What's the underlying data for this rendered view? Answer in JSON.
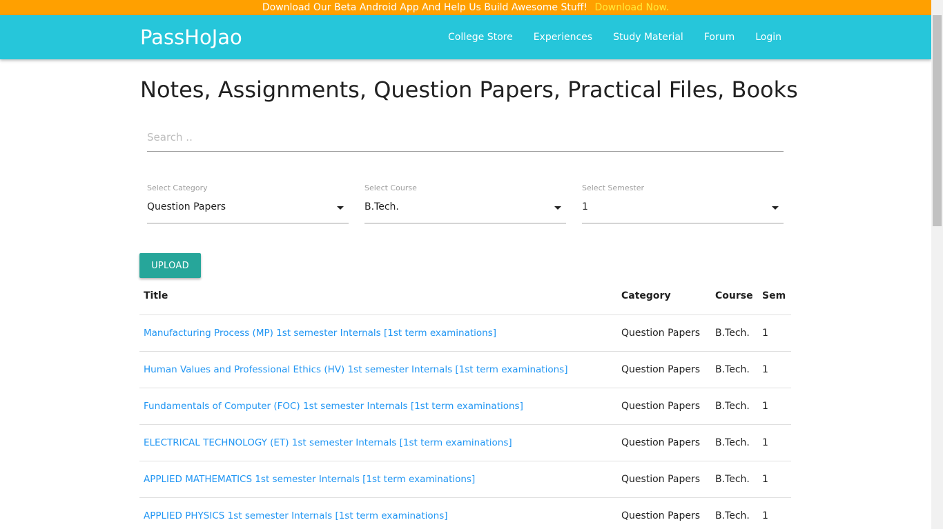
{
  "banner": {
    "text": "Download Our Beta Android App And Help Us Build Awesome Stuff!",
    "link": "Download Now."
  },
  "navbar": {
    "brand": "PassHoJao",
    "links": [
      "College Store",
      "Experiences",
      "Study Material",
      "Forum",
      "Login"
    ]
  },
  "page": {
    "title": "Notes, Assignments, Question Papers, Practical Files, Books"
  },
  "search": {
    "placeholder": "Search .."
  },
  "filters": {
    "category": {
      "label": "Select Category",
      "value": "Question Papers"
    },
    "course": {
      "label": "Select Course",
      "value": "B.Tech."
    },
    "semester": {
      "label": "Select Semester",
      "value": "1"
    }
  },
  "upload": {
    "label": "UPLOAD"
  },
  "table": {
    "headers": [
      "Title",
      "Category",
      "Course",
      "Sem"
    ],
    "rows": [
      {
        "title": "Manufacturing Process (MP) 1st semester Internals [1st term examinations]",
        "category": "Question Papers",
        "course": "B.Tech.",
        "sem": "1"
      },
      {
        "title": "Human Values and Professional Ethics (HV) 1st semester Internals [1st term examinations]",
        "category": "Question Papers",
        "course": "B.Tech.",
        "sem": "1"
      },
      {
        "title": "Fundamentals of Computer (FOC) 1st semester Internals [1st term examinations]",
        "category": "Question Papers",
        "course": "B.Tech.",
        "sem": "1"
      },
      {
        "title": "ELECTRICAL TECHNOLOGY (ET) 1st semester Internals [1st term examinations]",
        "category": "Question Papers",
        "course": "B.Tech.",
        "sem": "1"
      },
      {
        "title": "APPLIED MATHEMATICS 1st semester Internals [1st term examinations]",
        "category": "Question Papers",
        "course": "B.Tech.",
        "sem": "1"
      },
      {
        "title": "APPLIED PHYSICS 1st semester Internals [1st term examinations]",
        "category": "Question Papers",
        "course": "B.Tech.",
        "sem": "1"
      }
    ]
  },
  "colors": {
    "banner": "#ffa000",
    "navbar": "#26c6da",
    "upload_button": "#26a69a",
    "link": "#2196f3"
  }
}
